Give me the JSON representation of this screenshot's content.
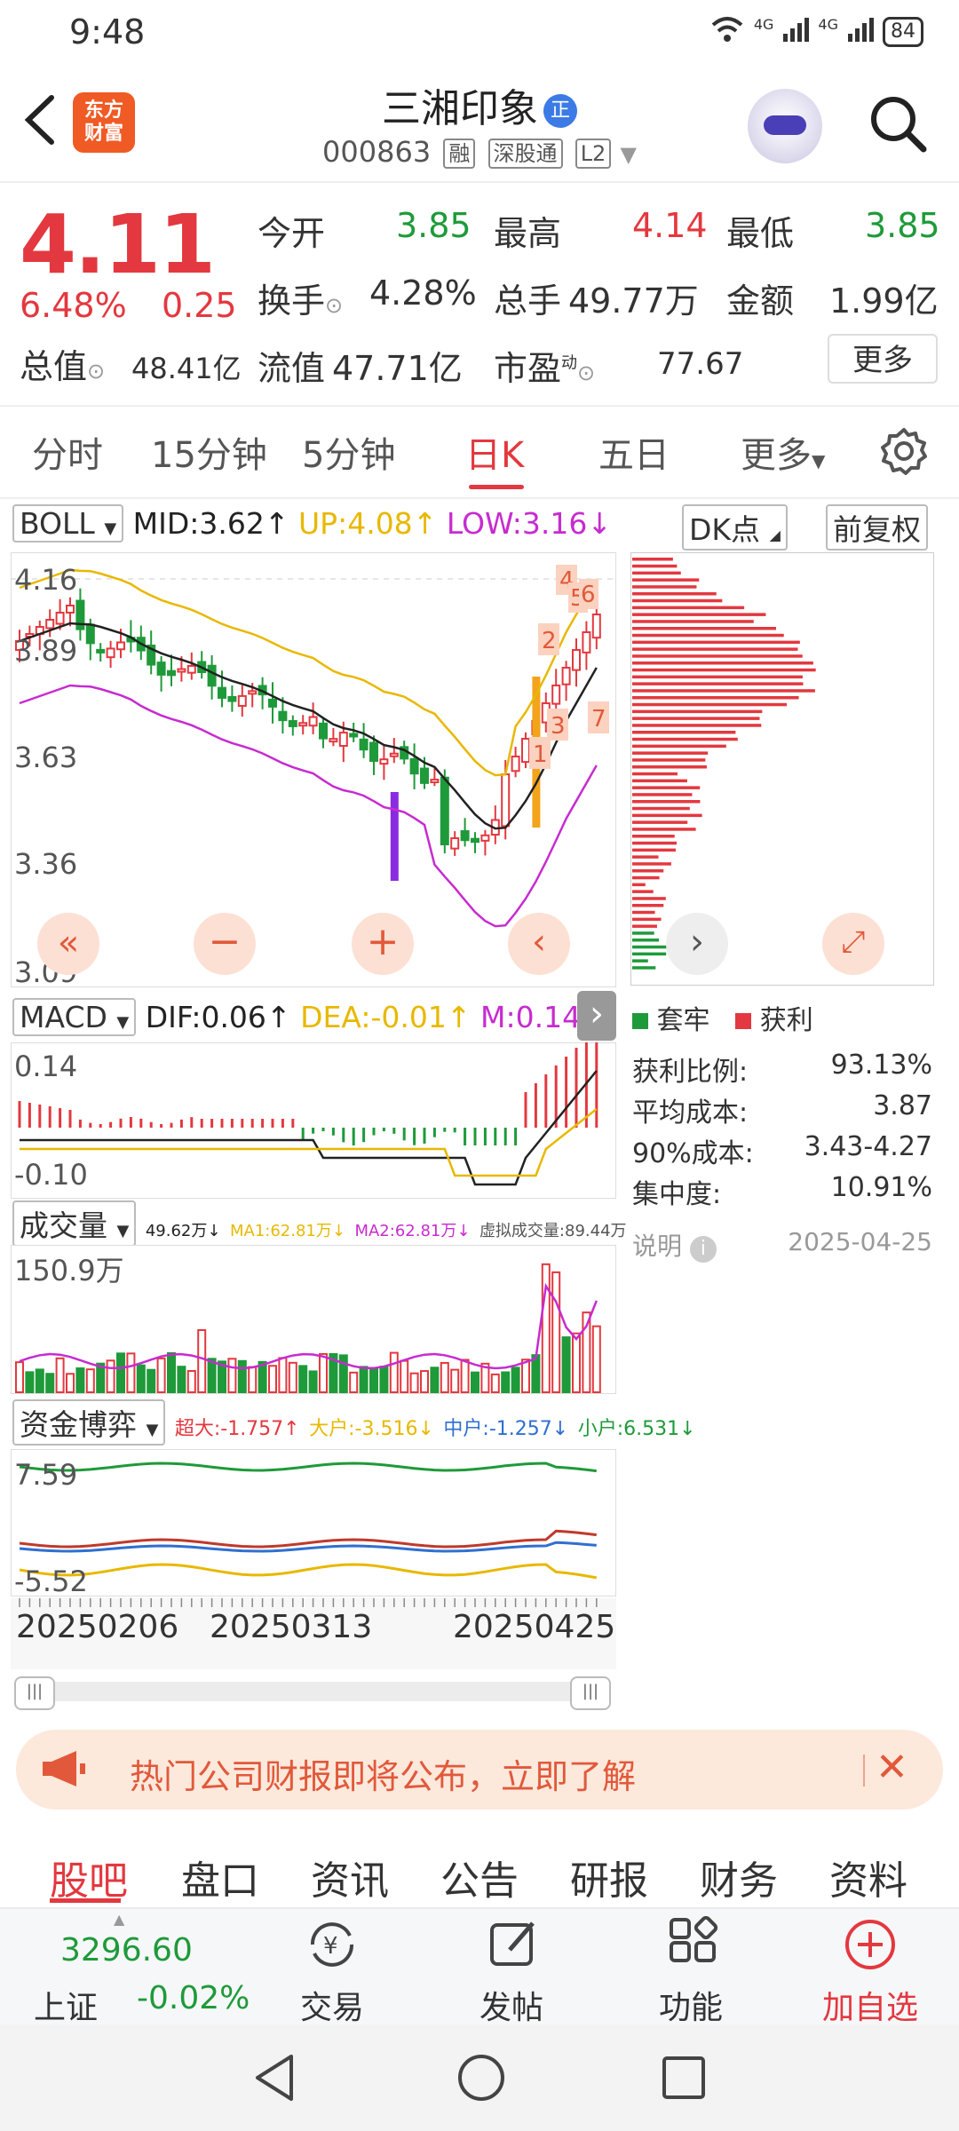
{
  "status": {
    "time": "9:48",
    "network": "4G",
    "battery": "84"
  },
  "header": {
    "logo_line1": "东方",
    "logo_line2": "财富",
    "title": "三湘印象",
    "title_badge": "正",
    "code": "000863",
    "tags": [
      "融",
      "深股通",
      "L2"
    ]
  },
  "quote": {
    "price": "4.11",
    "change_pct": "6.48%",
    "change": "0.25",
    "mktcap_label": "总值",
    "mktcap": "48.41亿",
    "open_label": "今开",
    "open": "3.85",
    "high_label": "最高",
    "high": "4.14",
    "low_label": "最低",
    "low": "3.85",
    "turnover_label": "换手",
    "turnover": "4.28%",
    "volume_label": "总手",
    "volume": "49.77万",
    "amount_label": "金额",
    "amount": "1.99亿",
    "float_label": "流值",
    "float": "47.71亿",
    "pe_label": "市盈",
    "pe_sup": "动",
    "pe": "77.67",
    "more": "更多"
  },
  "tabs": [
    "分时",
    "15分钟",
    "5分钟",
    "日K",
    "五日",
    "更多"
  ],
  "active_tab": "日K",
  "boll": {
    "name": "BOLL",
    "mid": "MID:3.62",
    "up": "UP:4.08",
    "low": "LOW:3.16",
    "dk": "DK点",
    "fq": "前复权"
  },
  "price_axis": [
    "4.16",
    "3.89",
    "3.63",
    "3.36",
    "3.09"
  ],
  "markers": [
    "1",
    "2",
    "3",
    "4",
    "5",
    "6",
    "7"
  ],
  "macd": {
    "name": "MACD",
    "dif": "DIF:0.06",
    "dea": "DEA:-0.01",
    "m": "M:0.14",
    "top": "0.14",
    "bottom": "-0.10"
  },
  "volume": {
    "name": "成交量",
    "vol": "49.62万",
    "ma1": "MA1:62.81万",
    "ma2": "MA2:62.81万",
    "virtual": "虚拟成交量:89.44万",
    "top": "150.9万"
  },
  "fund": {
    "name": "资金博弈",
    "super": "超大:-1.757",
    "large": "大户:-3.516",
    "mid": "中户:-1.257",
    "small": "小户:6.531",
    "top": "7.59",
    "bottom": "-5.52"
  },
  "dates": [
    "20250206",
    "20250313",
    "20250425"
  ],
  "chip": {
    "legend_trapped": "套牢",
    "legend_profit": "获利",
    "profit_ratio_label": "获利比例:",
    "profit_ratio": "93.13%",
    "avg_cost_label": "平均成本:",
    "avg_cost": "3.87",
    "cost90_label": "90%成本:",
    "cost90": "3.43-4.27",
    "concentration_label": "集中度:",
    "concentration": "10.91%",
    "note_label": "说明",
    "date": "2025-04-25"
  },
  "banner": {
    "text": "热门公司财报即将公布，立即了解"
  },
  "bottom_tabs": [
    "股吧",
    "盘口",
    "资讯",
    "公告",
    "研报",
    "财务",
    "资料"
  ],
  "toolbar": {
    "index_value": "3296.60",
    "index_name": "上证",
    "index_change": "-0.02%",
    "trade": "交易",
    "post": "发帖",
    "function": "功能",
    "watchlist": "加自选"
  },
  "colors": {
    "red": "#e3383f",
    "green": "#1e9a3a",
    "yellow": "#e8b800",
    "magenta": "#c72bd0",
    "blue": "#2f6fd0",
    "orange": "#f3a41a"
  }
}
